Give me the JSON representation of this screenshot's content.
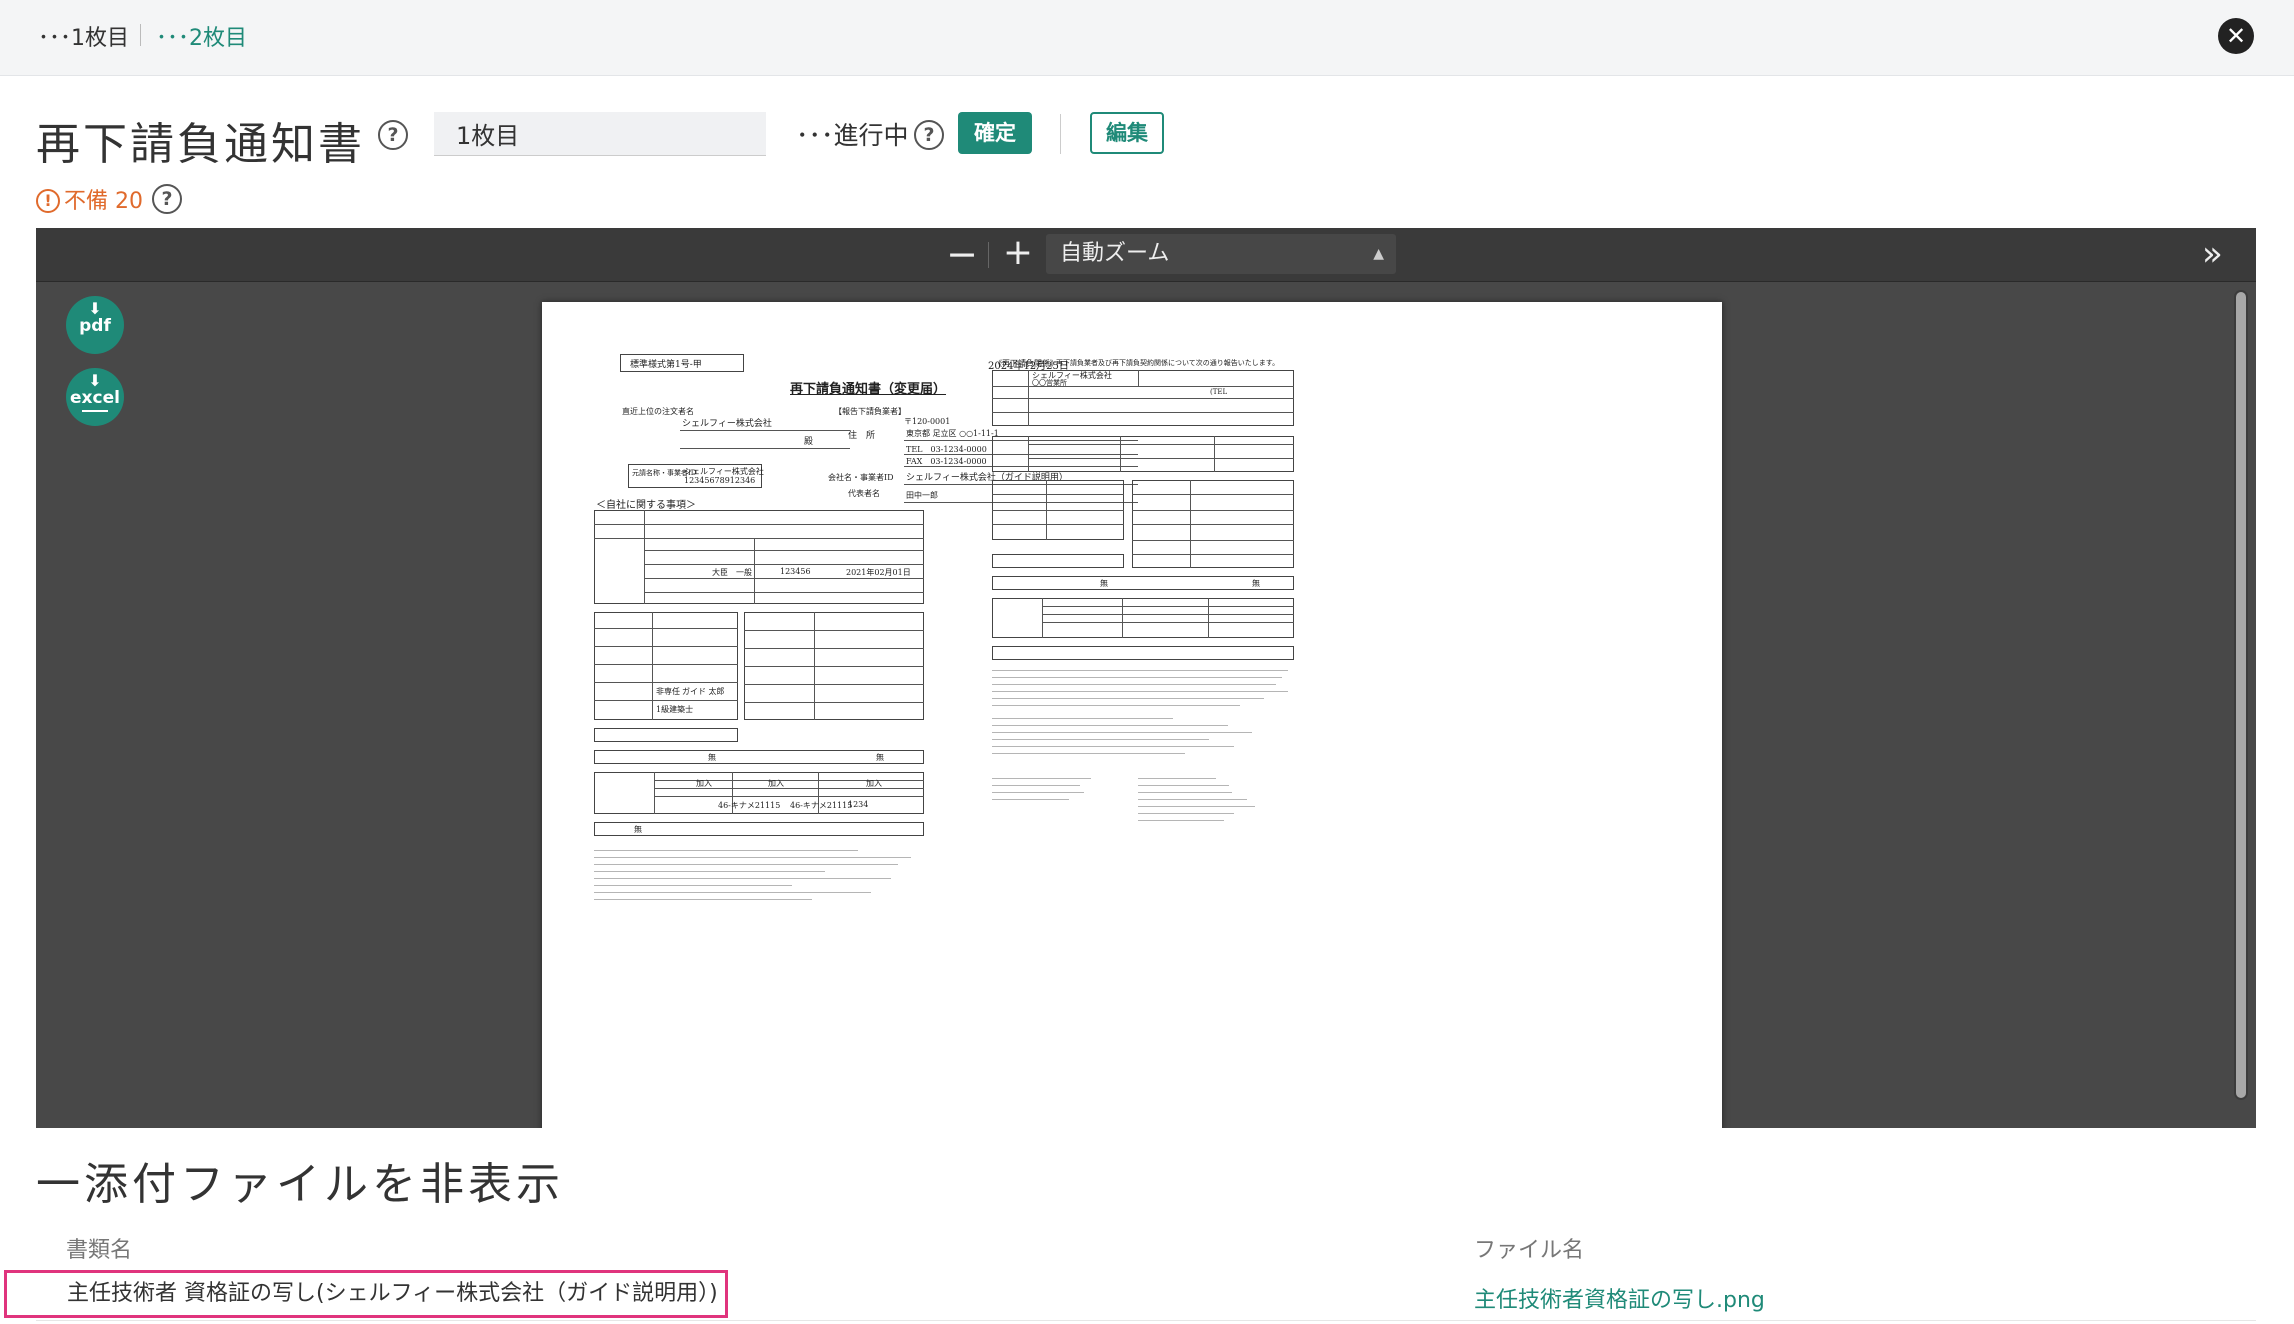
{
  "breadcrumb": {
    "first": "･･･1枚目",
    "second": "･･･2枚目"
  },
  "header": {
    "title": "再下請負通知書",
    "help": "?",
    "sheet_value": "1枚目",
    "status": "･･･進行中",
    "confirm_label": "確定",
    "edit_label": "編集"
  },
  "warning": {
    "icon": "!",
    "text": "不備 20"
  },
  "viewer": {
    "zoom_minus": "−",
    "zoom_plus": "+",
    "zoom_label": "自動ズーム",
    "sidebar_toggle": "»",
    "download_pdf": "pdf",
    "download_excel": "excel",
    "document": {
      "form_no": "標準様式第1号-甲",
      "date": "2024年12月25日",
      "title": "再下請負通知書（変更届）",
      "direct_client_label": "直近上位の注文者名",
      "direct_client": "シェルフィー株式会社",
      "honorific": "殿",
      "reporter_label": "【報告下請負業者】",
      "postal": "〒120-0001",
      "address_label": "住　所",
      "address": "東京都 足立区 ○○1-11-1",
      "tel": "TEL　03-1234-0000",
      "fax": "FAX　03-1234-0000",
      "company_id_label": "会社名・事業者ID",
      "company_name": "シェルフィー株式会社（ガイド説明用）",
      "rep_label": "代表者名",
      "rep_name": "田中一郎",
      "prime_label": "元請名称・事業者ID",
      "prime_name": "シェルフィー株式会社",
      "prime_id": "12345678912346",
      "own_section": "＜自社に関する事項＞",
      "license_date": "2021年02月01日",
      "license_no": "123456",
      "license_work": "大臣　一般",
      "engineer_type": "非専任",
      "engineer_name": "ガイド 太郎",
      "qualification": "1級建築士",
      "none1": "無",
      "none2": "無",
      "insurance_no1": "46-キナメ21115",
      "insurance_no2": "46-キナメ21115",
      "insurance_no3": "1234",
      "join_label": "加入",
      "right_title": "《再下請負関係》",
      "right_desc": "再下請負業者及び再下請負契約関係について次の通り報告いたします。",
      "right_company": "シェルフィー株式会社",
      "right_office": "〇〇営業所",
      "right_tel": "(TEL",
      "right_none1": "無",
      "right_none2": "無"
    }
  },
  "attachments": {
    "toggle_label": "一添付ファイルを非表示",
    "col_doc": "書類名",
    "col_file": "ファイル名",
    "rows": [
      {
        "doc_name": "主任技術者 資格証の写し(シェルフィー株式会社（ガイド説明用）)",
        "file_name": "主任技術者資格証の写し.png"
      }
    ]
  },
  "colors": {
    "accent": "#1f8a78",
    "warning": "#e06a2c",
    "highlight": "#e0347d",
    "viewer_bg": "#484848"
  },
  "icons": [
    "help-icon",
    "close-icon",
    "warning-icon",
    "pdf-download-icon",
    "excel-download-icon",
    "sidebar-toggle-icon"
  ]
}
